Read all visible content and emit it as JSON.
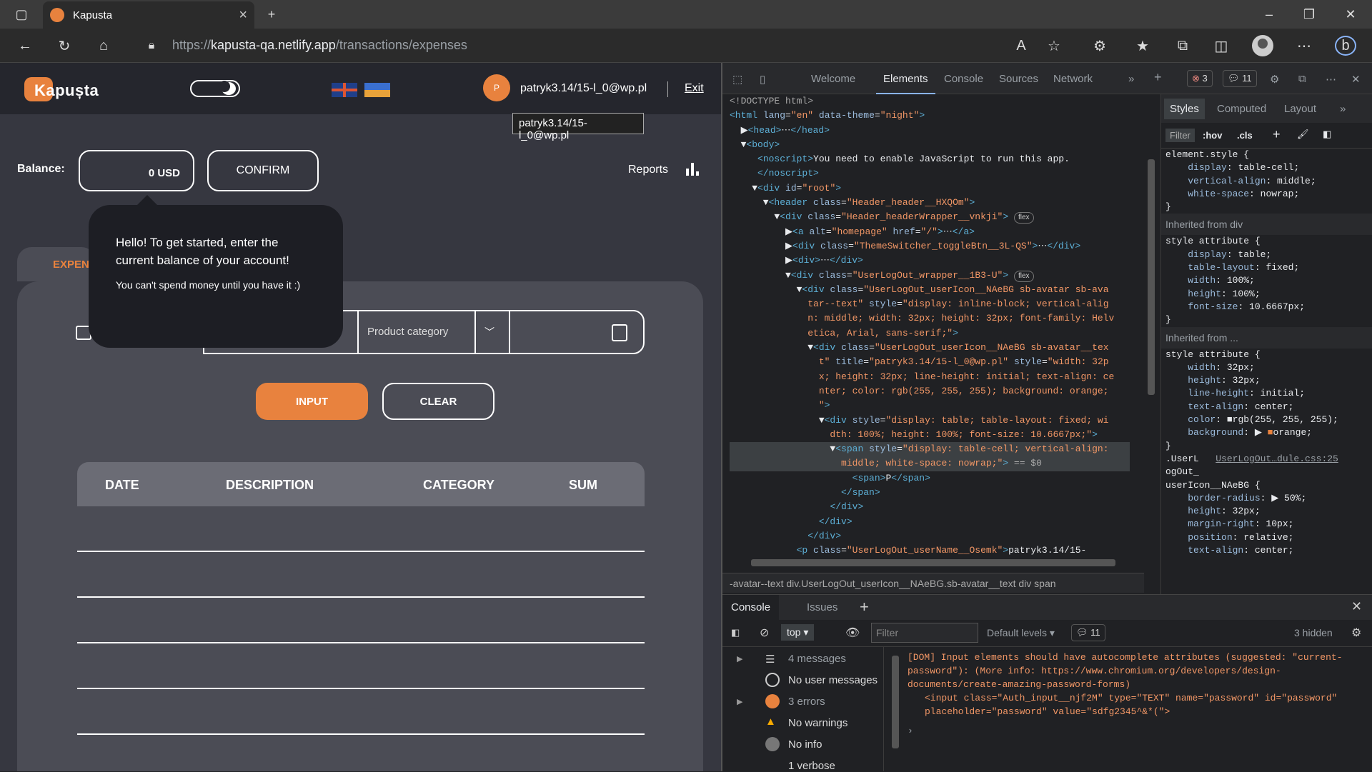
{
  "browser": {
    "tab_title": "Kapusta",
    "url_prefix": "https://",
    "url_host": "kapusta-qa.netlify.app",
    "url_path": "/transactions/expenses"
  },
  "app": {
    "logo_text": "Kapușta",
    "user_initial": "P",
    "user_email": "patryk3.14/15-l_0@wp.pl",
    "exit_label": "Exit",
    "tooltip": "patryk3.14/15-l_0@wp.pl",
    "balance_label": "Balance:",
    "balance_value": "0 USD",
    "confirm_label": "CONFIRM",
    "reports_label": "Reports",
    "expenses_tab": "EXPEN",
    "category_placeholder": "Product category",
    "input_label": "INPUT",
    "clear_label": "CLEAR",
    "table_headers": [
      "DATE",
      "DESCRIPTION",
      "CATEGORY",
      "SUM"
    ],
    "popup_title": "Hello! To get started, enter the current balance of your account!",
    "popup_text": "You can't spend money until you have it :)"
  },
  "devtools": {
    "tabs": [
      "Welcome",
      "Elements",
      "Console",
      "Sources",
      "Network"
    ],
    "errors_count": "3",
    "messages_count": "11",
    "styles_tabs": [
      "Styles",
      "Computed",
      "Layout"
    ],
    "filter_placeholder": "Filter",
    "hov": ":hov",
    "cls": ".cls",
    "breadcrumb": "-avatar--text    div.UserLogOut_userIcon__NAeBG.sb-avatar__text    div    span",
    "console_tabs": [
      "Console",
      "Issues"
    ],
    "context": "top",
    "default_levels": "Default levels",
    "hidden": "3 hidden",
    "console_filter": "Filter",
    "sidebar": [
      "4 messages",
      "No user messages",
      "3 errors",
      "No warnings",
      "No info",
      "1 verbose"
    ],
    "console_message": "[DOM] Input elements should have autocomplete attributes (suggested: \"current-password\"): (More info: https://www.chromium.org/developers/design-documents/create-amazing-password-forms)",
    "console_snippet": "<input class=\"Auth_input__njf2M\" type=\"TEXT\" name=\"password\" id=\"password\" placeholder=\"password\" value=\"sdfg2345^&*(\">"
  },
  "colors": {
    "accent": "#e8823e",
    "page_bg": "#363740"
  }
}
